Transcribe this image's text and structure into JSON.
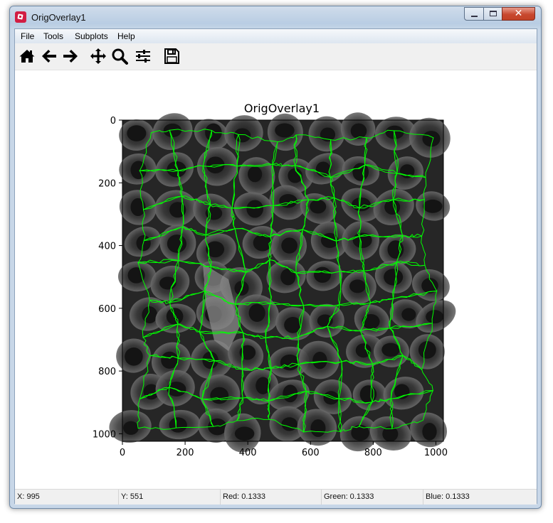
{
  "window": {
    "title": "OrigOverlay1",
    "close_label": "✕"
  },
  "menu": [
    "File",
    "Tools",
    "Subplots",
    "Help"
  ],
  "toolbar": {
    "items": [
      "home-icon",
      "back-arrow-icon",
      "forward-arrow-icon",
      "pan-icon",
      "zoom-icon",
      "subplots-configure-icon",
      "save-icon"
    ]
  },
  "chart_data": {
    "type": "image",
    "title": "OrigOverlay1",
    "x_ticks": [
      "0",
      "200",
      "400",
      "600",
      "800",
      "1000"
    ],
    "y_ticks": [
      "0",
      "200",
      "400",
      "600",
      "800",
      "1000"
    ],
    "xlim": [
      0,
      1024
    ],
    "ylim": [
      1024,
      0
    ],
    "overlay_color": "#00ff00",
    "background": "grayscale fluorescence image of cells with green cell boundary outlines"
  },
  "status": {
    "x": "X: 995",
    "y": "Y: 551",
    "red": "Red: 0.1333",
    "green": "Green: 0.1333",
    "blue": "Blue: 0.1333"
  }
}
